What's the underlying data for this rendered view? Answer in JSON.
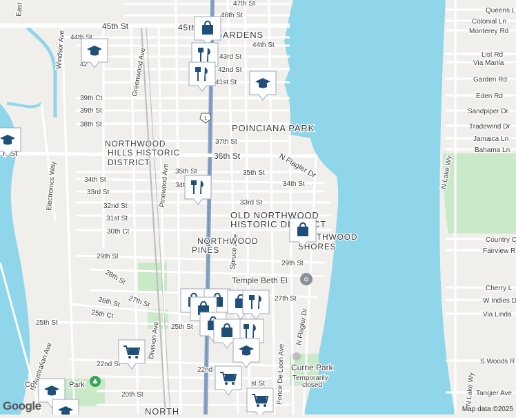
{
  "colors": {
    "land": "#f1efec",
    "water": "#8fd6ea",
    "park": "#c9e9c8",
    "street": "#ffffff",
    "highway": "#8aa4c8",
    "pin": "#1f4e79"
  },
  "street_labels": [
    {
      "text": "47th St"
    },
    {
      "text": "46th St"
    },
    {
      "text": "45th St"
    },
    {
      "text": "45th St"
    },
    {
      "text": "44th St"
    },
    {
      "text": "44th St"
    },
    {
      "text": "43rd St"
    },
    {
      "text": "42nd St"
    },
    {
      "text": "41st St"
    },
    {
      "text": "39th Ct"
    },
    {
      "text": "39th St"
    },
    {
      "text": "38th St"
    },
    {
      "text": "37th St"
    },
    {
      "text": "36th St"
    },
    {
      "text": "35th St"
    },
    {
      "text": "35th St"
    },
    {
      "text": "34th St"
    },
    {
      "text": "34th St"
    },
    {
      "text": "34t"
    },
    {
      "text": "33rd St"
    },
    {
      "text": "33rd St"
    },
    {
      "text": "32nd St"
    },
    {
      "text": "31st St"
    },
    {
      "text": "30th Ct"
    },
    {
      "text": "29th St"
    },
    {
      "text": "29th St"
    },
    {
      "text": "28th St"
    },
    {
      "text": "27th St"
    },
    {
      "text": "27th St"
    },
    {
      "text": "26th St"
    },
    {
      "text": "25th Ct"
    },
    {
      "text": "25th St"
    },
    {
      "text": "25th St"
    },
    {
      "text": "22nd St"
    },
    {
      "text": "22nd"
    },
    {
      "text": "20th St"
    },
    {
      "text": "st St"
    },
    {
      "text": "N Flagler Dr"
    },
    {
      "text": "N Flagler Dr"
    },
    {
      "text": "Spruce Ave"
    },
    {
      "text": "Ponce De Leon Ave"
    },
    {
      "text": "Pinewood Ave"
    },
    {
      "text": "Greenwood Ave"
    },
    {
      "text": "Windsor Ave"
    },
    {
      "text": "Electronics Way"
    },
    {
      "text": "N Australian Ave"
    },
    {
      "text": "Division Ave"
    },
    {
      "text": "Queens Ln"
    },
    {
      "text": "Colonial Ln"
    },
    {
      "text": "Monterey Rd"
    },
    {
      "text": "List Rd"
    },
    {
      "text": "Via Marila"
    },
    {
      "text": "Garden Rd"
    },
    {
      "text": "Eden Rd"
    },
    {
      "text": "Sandpiper Dr"
    },
    {
      "text": "Tradewind Dr"
    },
    {
      "text": "Jamaica Ln"
    },
    {
      "text": "Bahama Ln"
    },
    {
      "text": "N Lake Wy"
    },
    {
      "text": "Country C"
    },
    {
      "text": "Fairview R"
    },
    {
      "text": "Cherry L"
    },
    {
      "text": "W Indies D"
    },
    {
      "text": "Via Linda"
    },
    {
      "text": "S Woods R"
    },
    {
      "text": "Tangier Ave"
    },
    {
      "text": "N Lake Wy"
    },
    {
      "text": "East"
    },
    {
      "text": "h St"
    },
    {
      "text": "42"
    }
  ],
  "area_labels": [
    {
      "text": "45th St"
    },
    {
      "text": "GARDENS"
    },
    {
      "text": "POINCIANA PARK"
    },
    {
      "text": "NORTHWOOD"
    },
    {
      "text": "HILLS HISTORIC"
    },
    {
      "text": "DISTRICT"
    },
    {
      "text": "OLD NORTHWOOD"
    },
    {
      "text": "HISTORIC DISTRICT"
    },
    {
      "text": "NORTHWOOD"
    },
    {
      "text": "PINES"
    },
    {
      "text": "NORTHWOOD"
    },
    {
      "text": "SHORES"
    },
    {
      "text": "NORTH"
    }
  ],
  "poi_labels": [
    {
      "text": "Temple Beth El"
    },
    {
      "text": "Currie Park"
    },
    {
      "text": "Temporarily"
    },
    {
      "text": "closed"
    },
    {
      "text": "Co"
    },
    {
      "text": "Park"
    }
  ],
  "route_shield": "1",
  "pins": [
    {
      "icon": "shopping-bag-icon"
    },
    {
      "icon": "restaurant-icon"
    },
    {
      "icon": "restaurant-icon"
    },
    {
      "icon": "school-icon"
    },
    {
      "icon": "school-icon"
    },
    {
      "icon": "school-icon"
    },
    {
      "icon": "restaurant-icon"
    },
    {
      "icon": "shopping-bag-icon"
    },
    {
      "icon": "shopping-bag-icon"
    },
    {
      "icon": "shopping-bag-icon"
    },
    {
      "icon": "shopping-bag-icon"
    },
    {
      "icon": "shopping-bag-icon"
    },
    {
      "icon": "restaurant-icon"
    },
    {
      "icon": "shopping-bag-icon"
    },
    {
      "icon": "restaurant-icon"
    },
    {
      "icon": "shopping-bag-icon"
    },
    {
      "icon": "school-icon"
    },
    {
      "icon": "shopping-cart-icon"
    },
    {
      "icon": "shopping-cart-icon"
    },
    {
      "icon": "shopping-cart-icon"
    },
    {
      "icon": "school-icon"
    },
    {
      "icon": "school-icon"
    }
  ],
  "attribution": "Map data ©2025",
  "logo": "Google"
}
